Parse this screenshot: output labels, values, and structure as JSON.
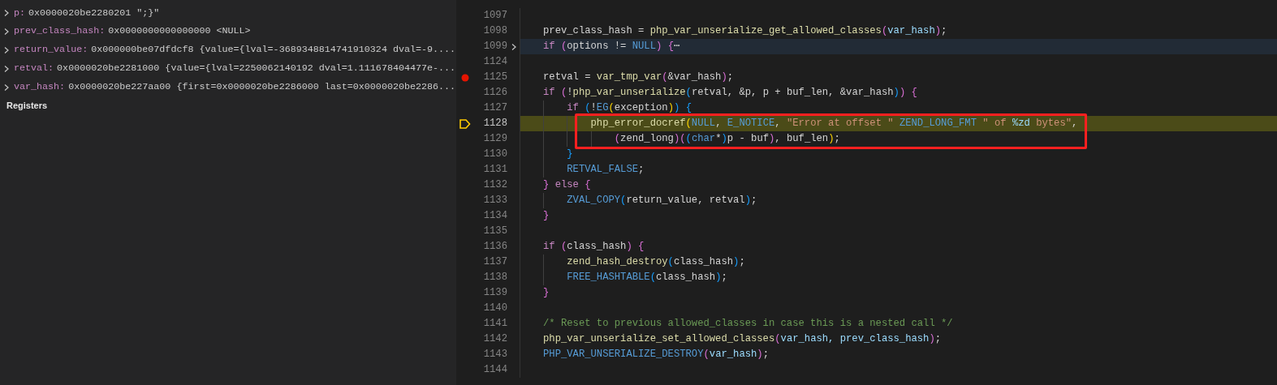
{
  "variables": [
    {
      "name": "p:",
      "value": "0x0000020be2280201 \";}\"",
      "expanded": false
    },
    {
      "name": "prev_class_hash:",
      "value": "0x0000000000000000 <NULL>",
      "expanded": false
    },
    {
      "name": "return_value:",
      "value": "0x000000be07dfdcf8 {value={lval=-3689348814741910324 dval=-9....",
      "expanded": false
    },
    {
      "name": "retval:",
      "value": "0x0000020be2281000 {value={lval=2250062140192 dval=1.111678404477e-...",
      "expanded": false
    },
    {
      "name": "var_hash:",
      "value": "0x0000020be227aa00 {first=0x0000020be2286000 last=0x0000020be2286...",
      "expanded": false
    }
  ],
  "sections": [
    {
      "title": "Registers",
      "expanded": false
    }
  ],
  "editor": {
    "lines": [
      {
        "number": "1097",
        "folded": false,
        "boxed": false
      },
      {
        "number": "1098",
        "folded": false,
        "boxed": false,
        "tokens": [
          {
            "kind": "plain",
            "text": "prev_class_hash = "
          },
          {
            "kind": "function",
            "text": "php_var_unserialize_get_allowed_classes"
          },
          {
            "kind": "bracket2",
            "text": "("
          },
          {
            "kind": "variable",
            "text": "var_hash"
          },
          {
            "kind": "bracket2",
            "text": ")"
          },
          {
            "kind": "plain",
            "text": ";"
          }
        ]
      },
      {
        "number": "1099",
        "folded": true,
        "boxed": false,
        "tokens": [
          {
            "kind": "keyword",
            "text": "if "
          },
          {
            "kind": "bracket2",
            "text": "("
          },
          {
            "kind": "plain",
            "text": "options != "
          },
          {
            "kind": "macro",
            "text": "NULL"
          },
          {
            "kind": "bracket2",
            "text": ")"
          },
          {
            "kind": "bracket2",
            "text": " {"
          },
          {
            "kind": "plain",
            "text": "⋯"
          }
        ]
      },
      {
        "number": "1124",
        "folded": false,
        "boxed": false
      },
      {
        "number": "1125",
        "kind": "breakpoint",
        "folded": false,
        "boxed": false,
        "tokens": [
          {
            "kind": "plain",
            "text": "retval = "
          },
          {
            "kind": "function",
            "text": "var_tmp_var"
          },
          {
            "kind": "bracket2",
            "text": "("
          },
          {
            "kind": "plain",
            "text": "&var_hash"
          },
          {
            "kind": "bracket2",
            "text": ")"
          },
          {
            "kind": "plain",
            "text": ";"
          }
        ]
      },
      {
        "number": "1126",
        "folded": false,
        "boxed": false,
        "tokens": [
          {
            "kind": "keyword",
            "text": "if "
          },
          {
            "kind": "bracket2",
            "text": "("
          },
          {
            "kind": "plain",
            "text": "!"
          },
          {
            "kind": "function",
            "text": "php_var_unserialize"
          },
          {
            "kind": "bracket3",
            "text": "("
          },
          {
            "kind": "plain",
            "text": "retval, &p, p + buf_len, &var_hash"
          },
          {
            "kind": "bracket3",
            "text": ")"
          },
          {
            "kind": "bracket2",
            "text": ")"
          },
          {
            "kind": "bracket2",
            "text": " {"
          }
        ]
      },
      {
        "number": "1127",
        "folded": false,
        "boxed": false,
        "tokens": [
          {
            "kind": "keyword",
            "text": "    if "
          },
          {
            "kind": "bracket3",
            "text": "("
          },
          {
            "kind": "plain",
            "text": "!"
          },
          {
            "kind": "macro",
            "text": "EG"
          },
          {
            "kind": "bracket1",
            "text": "("
          },
          {
            "kind": "plain",
            "text": "exception"
          },
          {
            "kind": "bracket1",
            "text": ")"
          },
          {
            "kind": "bracket3",
            "text": ")"
          },
          {
            "kind": "bracket3",
            "text": " {"
          }
        ]
      },
      {
        "number": "1128",
        "kind": "current",
        "folded": false,
        "boxed": true,
        "tokens": [
          {
            "kind": "function",
            "text": "        php_error_docref"
          },
          {
            "kind": "bracket1",
            "text": "("
          },
          {
            "kind": "macro",
            "text": "NULL"
          },
          {
            "kind": "plain",
            "text": ", "
          },
          {
            "kind": "macro",
            "text": "E_NOTICE"
          },
          {
            "kind": "plain",
            "text": ", "
          },
          {
            "kind": "string",
            "text": "\"Error at offset \""
          },
          {
            "kind": "macro",
            "text": " ZEND_LONG_FMT"
          },
          {
            "kind": "string",
            "text": " \" of "
          },
          {
            "kind": "variable",
            "text": "%zd"
          },
          {
            "kind": "string",
            "text": " bytes\""
          },
          {
            "kind": "plain",
            "text": ","
          }
        ]
      },
      {
        "number": "1129",
        "folded": false,
        "boxed": true,
        "tokens": [
          {
            "kind": "bracket2",
            "text": "            ("
          },
          {
            "kind": "plain",
            "text": "zend_long"
          },
          {
            "kind": "bracket2",
            "text": ")"
          },
          {
            "kind": "bracket2",
            "text": "("
          },
          {
            "kind": "bracket3",
            "text": "("
          },
          {
            "kind": "macro",
            "text": "char"
          },
          {
            "kind": "plain",
            "text": "*"
          },
          {
            "kind": "bracket3",
            "text": ")"
          },
          {
            "kind": "plain",
            "text": "p - buf"
          },
          {
            "kind": "bracket2",
            "text": ")"
          },
          {
            "kind": "plain",
            "text": ", buf_len"
          },
          {
            "kind": "bracket1",
            "text": ")"
          },
          {
            "kind": "plain",
            "text": ";"
          }
        ]
      },
      {
        "number": "1130",
        "folded": false,
        "boxed": false,
        "tokens": [
          {
            "kind": "bracket3",
            "text": "    }"
          }
        ]
      },
      {
        "number": "1131",
        "folded": false,
        "boxed": false,
        "tokens": [
          {
            "kind": "macro",
            "text": "    RETVAL_FALSE"
          },
          {
            "kind": "plain",
            "text": ";"
          }
        ]
      },
      {
        "number": "1132",
        "folded": false,
        "boxed": false,
        "tokens": [
          {
            "kind": "bracket2",
            "text": "}"
          },
          {
            "kind": "keyword",
            "text": " else "
          },
          {
            "kind": "bracket2",
            "text": "{"
          }
        ]
      },
      {
        "number": "1133",
        "folded": false,
        "boxed": false,
        "tokens": [
          {
            "kind": "macro",
            "text": "    ZVAL_COPY"
          },
          {
            "kind": "bracket3",
            "text": "("
          },
          {
            "kind": "plain",
            "text": "return_value, retval"
          },
          {
            "kind": "bracket3",
            "text": ")"
          },
          {
            "kind": "plain",
            "text": ";"
          }
        ]
      },
      {
        "number": "1134",
        "folded": false,
        "boxed": false,
        "tokens": [
          {
            "kind": "bracket2",
            "text": "}"
          }
        ]
      },
      {
        "number": "1135",
        "folded": false,
        "boxed": false
      },
      {
        "number": "1136",
        "folded": false,
        "boxed": false,
        "tokens": [
          {
            "kind": "keyword",
            "text": "if "
          },
          {
            "kind": "bracket2",
            "text": "("
          },
          {
            "kind": "plain",
            "text": "class_hash"
          },
          {
            "kind": "bracket2",
            "text": ")"
          },
          {
            "kind": "bracket2",
            "text": " {"
          }
        ]
      },
      {
        "number": "1137",
        "folded": false,
        "boxed": false,
        "tokens": [
          {
            "kind": "function",
            "text": "    zend_hash_destroy"
          },
          {
            "kind": "bracket3",
            "text": "("
          },
          {
            "kind": "plain",
            "text": "class_hash"
          },
          {
            "kind": "bracket3",
            "text": ")"
          },
          {
            "kind": "plain",
            "text": ";"
          }
        ]
      },
      {
        "number": "1138",
        "folded": false,
        "boxed": false,
        "tokens": [
          {
            "kind": "macro",
            "text": "    FREE_HASHTABLE"
          },
          {
            "kind": "bracket3",
            "text": "("
          },
          {
            "kind": "plain",
            "text": "class_hash"
          },
          {
            "kind": "bracket3",
            "text": ")"
          },
          {
            "kind": "plain",
            "text": ";"
          }
        ]
      },
      {
        "number": "1139",
        "folded": false,
        "boxed": false,
        "tokens": [
          {
            "kind": "bracket2",
            "text": "}"
          }
        ]
      },
      {
        "number": "1140",
        "folded": false,
        "boxed": false
      },
      {
        "number": "1141",
        "folded": false,
        "boxed": false,
        "tokens": [
          {
            "kind": "comment",
            "text": "/* Reset to previous allowed_classes in case this is a nested call */"
          }
        ]
      },
      {
        "number": "1142",
        "folded": false,
        "boxed": false,
        "tokens": [
          {
            "kind": "function",
            "text": "php_var_unserialize_set_allowed_classes"
          },
          {
            "kind": "bracket2",
            "text": "("
          },
          {
            "kind": "variable",
            "text": "var_hash, prev_class_hash"
          },
          {
            "kind": "bracket2",
            "text": ")"
          },
          {
            "kind": "plain",
            "text": ";"
          }
        ]
      },
      {
        "number": "1143",
        "folded": false,
        "boxed": false,
        "tokens": [
          {
            "kind": "macro",
            "text": "PHP_VAR_UNSERIALIZE_DESTROY"
          },
          {
            "kind": "bracket2",
            "text": "("
          },
          {
            "kind": "variable",
            "text": "var_hash"
          },
          {
            "kind": "bracket2",
            "text": ")"
          },
          {
            "kind": "plain",
            "text": ";"
          }
        ]
      },
      {
        "number": "1144",
        "folded": false,
        "boxed": false
      }
    ]
  }
}
